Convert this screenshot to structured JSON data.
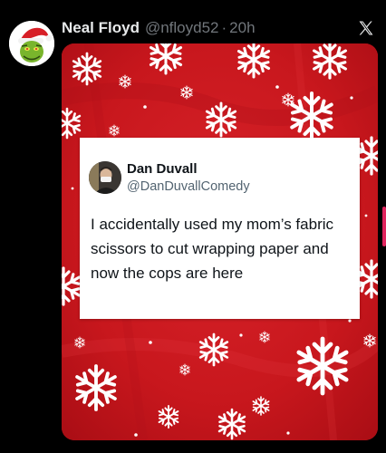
{
  "post": {
    "author_name": "Neal Floyd",
    "author_handle": "@nfloyd52",
    "separator": "·",
    "time": "20h"
  },
  "quoted_post": {
    "author_name": "Dan Duvall",
    "author_handle": "@DanDuvallComedy",
    "text": "I accidentally used my mom’s fabric scissors to cut wrapping paper and now the cops are here"
  },
  "icons": {
    "logo": "x-logo-icon",
    "background_pattern": "snowflake-icon"
  },
  "colors": {
    "background": "#000000",
    "wrapping_paper": "#c9161c",
    "name_text": "#e7e9ea",
    "secondary_text": "#71767b",
    "scroll_indicator": "#e0245e"
  }
}
